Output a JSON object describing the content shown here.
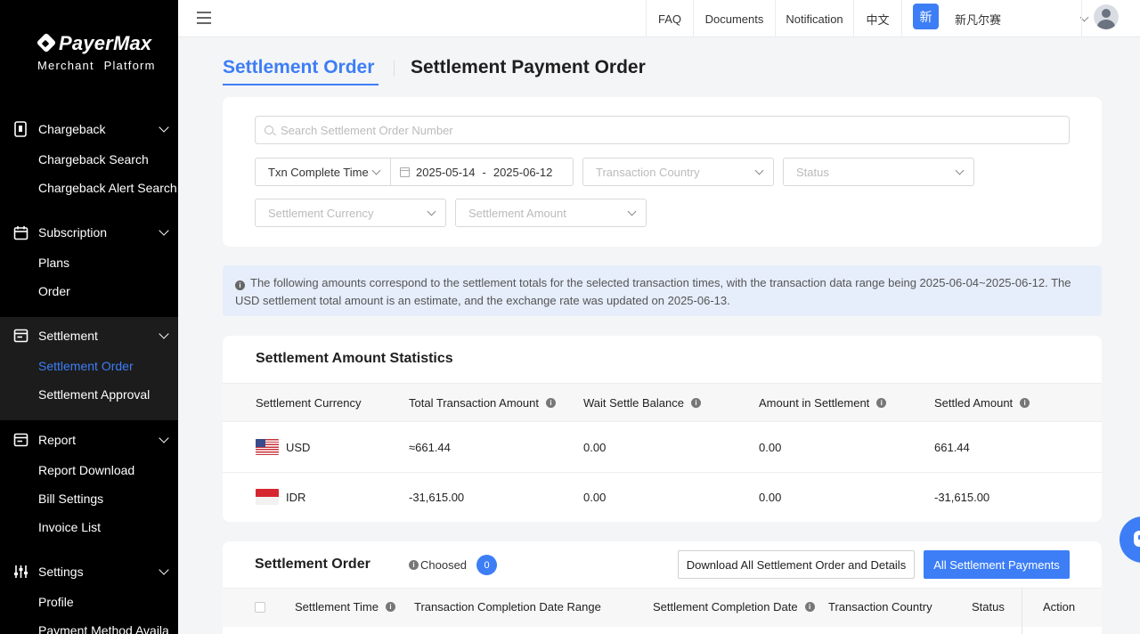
{
  "brand": {
    "name": "PayerMax",
    "subtitle": "Merchant Platform"
  },
  "sidebar": {
    "groups": [
      {
        "label": "Chargeback",
        "icon": "phone-icon",
        "items": [
          "Chargeback Search",
          "Chargeback Alert Search"
        ]
      },
      {
        "label": "Subscription",
        "icon": "calendar-icon",
        "items": [
          "Plans",
          "Order"
        ]
      },
      {
        "label": "Settlement",
        "icon": "settlement-icon",
        "items": [
          "Settlement Order",
          "Settlement Approval"
        ],
        "active_item": "Settlement Order"
      },
      {
        "label": "Report",
        "icon": "report-icon",
        "items": [
          "Report Download",
          "Bill Settings",
          "Invoice List"
        ]
      },
      {
        "label": "Settings",
        "icon": "sliders-icon",
        "items": [
          "Profile",
          "Payment Method Availa"
        ]
      }
    ]
  },
  "topbar": {
    "faq": "FAQ",
    "documents": "Documents",
    "notification": "Notification",
    "language": "中文",
    "new_badge": "新",
    "merchant": "新凡尔赛"
  },
  "tabs": {
    "settlement_order": "Settlement Order",
    "settlement_payment_order": "Settlement Payment Order",
    "active": "settlement_order"
  },
  "filters": {
    "search_placeholder": "Search Settlement Order Number",
    "time_type": "Txn Complete Time",
    "date_start": "2025-05-14",
    "date_sep": "-",
    "date_end": "2025-06-12",
    "country_placeholder": "Transaction Country",
    "status_placeholder": "Status",
    "currency_placeholder": "Settlement Currency",
    "amount_placeholder": "Settlement Amount"
  },
  "notice": {
    "text": "The following amounts correspond to the settlement totals for the selected transaction times, with the transaction data range being 2025-06-04~2025-06-12. The USD settlement total amount is an estimate, and the exchange rate was updated on 2025-06-13."
  },
  "stats": {
    "title": "Settlement Amount Statistics",
    "headers": [
      "Settlement Currency",
      "Total Transaction Amount",
      "Wait Settle Balance",
      "Amount in Settlement",
      "Settled Amount"
    ],
    "rows": [
      {
        "currency": "USD",
        "flag": "us-flag-icon",
        "total": "≈661.44",
        "wait": "0.00",
        "in_settlement": "0.00",
        "settled": "661.44"
      },
      {
        "currency": "IDR",
        "flag": "id-flag-icon",
        "total": "-31,615.00",
        "wait": "0.00",
        "in_settlement": "0.00",
        "settled": "-31,615.00"
      }
    ]
  },
  "orders": {
    "title": "Settlement Order",
    "choosed_label": "Choosed",
    "choosed_count": "0",
    "download_button": "Download All Settlement Order and Details",
    "payments_button": "All Settlement Payments",
    "headers": [
      "Settlement Time",
      "Transaction Completion Date Range",
      "Settlement Completion Date",
      "Transaction Country",
      "Status",
      "Action"
    ]
  },
  "colors": {
    "accent": "#3d7ef6",
    "sidebar_bg": "#000000",
    "notice_bg": "#e6edfb"
  }
}
